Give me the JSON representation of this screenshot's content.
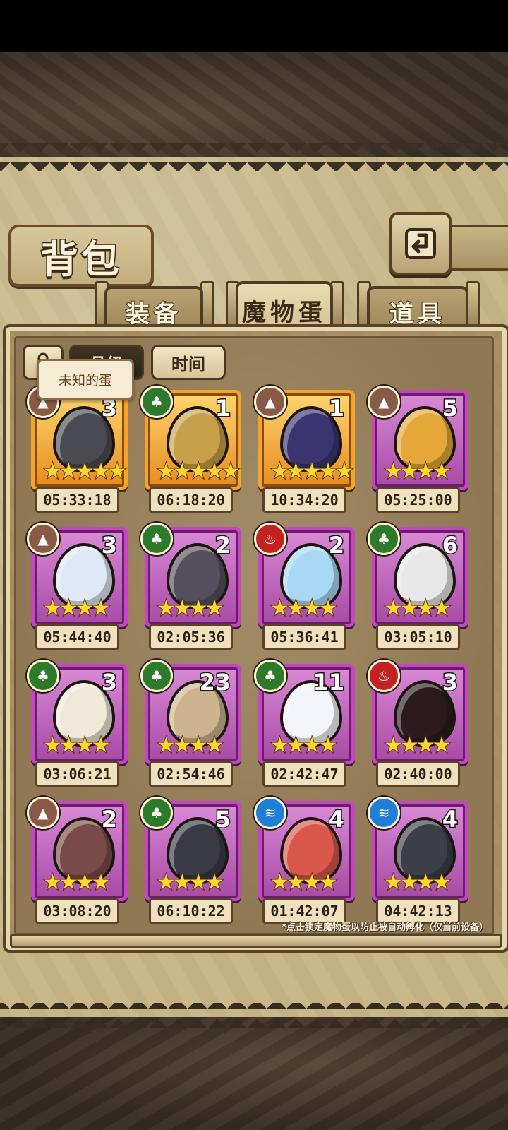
{
  "header": {
    "title": "背包"
  },
  "tabs": [
    {
      "label": "装备",
      "active": false
    },
    {
      "label": "魔物蛋",
      "active": true
    },
    {
      "label": "道具",
      "active": false
    }
  ],
  "sort": {
    "rarity_label": "品级",
    "time_label": "时间",
    "tooltip": "未知的蛋"
  },
  "colors": {
    "frame_epic": "#c247c0",
    "frame_legendary": "#f3a529",
    "star": "#ffd72e",
    "element_earth": "#8a5a48",
    "element_wood": "#2c7a2a",
    "element_fire": "#c42121",
    "element_water": "#1f7fd6"
  },
  "eggs": [
    {
      "element": "earth",
      "count": "3",
      "stars": "★★★★★",
      "timer": "05:33:18",
      "rarity": "gold",
      "icon": "scythe-wing-egg",
      "color": "#4a4a52"
    },
    {
      "element": "wood",
      "count": "1",
      "stars": "★★★★★",
      "timer": "06:18:20",
      "rarity": "gold",
      "icon": "magic-lamp-egg",
      "color": "#c9a04a"
    },
    {
      "element": "earth",
      "count": "1",
      "stars": "★★★★★",
      "timer": "10:34:20",
      "rarity": "gold",
      "icon": "crystal-rock-egg",
      "color": "#3a3570"
    },
    {
      "element": "earth",
      "count": "5",
      "stars": "★★★★",
      "timer": "05:25:00",
      "rarity": "epic",
      "icon": "furry-gem-egg",
      "color": "#e5a73a"
    },
    {
      "element": "earth",
      "count": "3",
      "stars": "★★★★",
      "timer": "05:44:40",
      "rarity": "epic",
      "icon": "crystal-ball-egg",
      "color": "#dfe8f5"
    },
    {
      "element": "wood",
      "count": "2",
      "stars": "★★★★",
      "timer": "02:05:36",
      "rarity": "epic",
      "icon": "spiked-collar-egg",
      "color": "#55505e"
    },
    {
      "element": "fire",
      "count": "2",
      "stars": "★★★★",
      "timer": "05:36:41",
      "rarity": "epic",
      "icon": "ice-flag-egg",
      "color": "#a9d8f5"
    },
    {
      "element": "wood",
      "count": "6",
      "stars": "★★★★",
      "timer": "03:05:10",
      "rarity": "epic",
      "icon": "horned-rune-egg",
      "color": "#e7e7e7"
    },
    {
      "element": "wood",
      "count": "3",
      "stars": "★★★★",
      "timer": "03:06:21",
      "rarity": "epic",
      "icon": "feathered-egg",
      "color": "#efe9d8"
    },
    {
      "element": "wood",
      "count": "23",
      "stars": "★★★★",
      "timer": "02:54:46",
      "rarity": "epic",
      "icon": "leaf-nest-egg",
      "color": "#cdb48f"
    },
    {
      "element": "wood",
      "count": "11",
      "stars": "★★★★",
      "timer": "02:42:47",
      "rarity": "epic",
      "icon": "winged-white-egg",
      "color": "#f4f4fb"
    },
    {
      "element": "fire",
      "count": "3",
      "stars": "★★★★",
      "timer": "02:40:00",
      "rarity": "epic",
      "icon": "dark-crystal-egg",
      "color": "#2c1b1e"
    },
    {
      "element": "earth",
      "count": "2",
      "stars": "★★★★",
      "timer": "03:08:20",
      "rarity": "epic",
      "icon": "horn-egg",
      "color": "#7a4a48"
    },
    {
      "element": "wood",
      "count": "5",
      "stars": "★★★★",
      "timer": "06:10:22",
      "rarity": "epic",
      "icon": "trident-wing-egg",
      "color": "#3a3a44"
    },
    {
      "element": "water",
      "count": "4",
      "stars": "★★★★",
      "timer": "01:42:07",
      "rarity": "epic",
      "icon": "feather-crown-egg",
      "color": "#d9574b"
    },
    {
      "element": "water",
      "count": "4",
      "stars": "★★★★",
      "timer": "04:42:13",
      "rarity": "epic",
      "icon": "spiked-shell-egg",
      "color": "#3c3f48"
    }
  ],
  "footnote": "*点击锁定魔物蛋以防止被自动孵化（仅当前设备）"
}
